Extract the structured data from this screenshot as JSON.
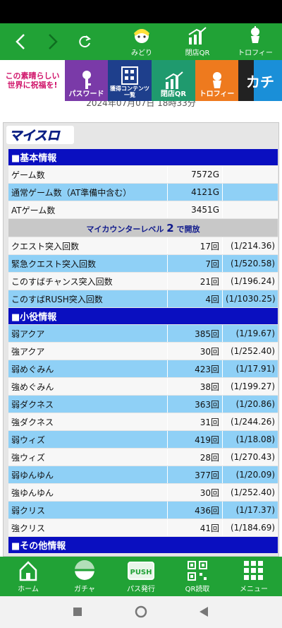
{
  "nav": {
    "midori_label": "みどり",
    "close_qr_label": "閉店QR",
    "trophy_label": "トロフィー"
  },
  "banner": {
    "promo_text": "この素晴らしい世界に祝福を!",
    "password_label": "パスワード",
    "contents_label": "獲得コンテンツ一覧",
    "close_qr_label": "閉店QR",
    "trophy_label": "トロフィー",
    "katana_label": "カチ"
  },
  "page": {
    "datetime": "2024年07月07日 18時33分",
    "logo_text": "マイスロ"
  },
  "basic": {
    "header": "■基本情報",
    "rows": [
      {
        "label": "ゲーム数",
        "value": "7572G",
        "ratio": ""
      },
      {
        "label": "通常ゲーム数（AT準備中含む）",
        "value": "4121G",
        "ratio": ""
      },
      {
        "label": "ATゲーム数",
        "value": "3451G",
        "ratio": ""
      }
    ],
    "notice_pre": "マイカウンターレベル ",
    "notice_level": "2",
    "notice_post": " で開放",
    "counts": [
      {
        "label": "クエスト突入回数",
        "value": "17回",
        "ratio": "(1/214.36)"
      },
      {
        "label": "緊急クエスト突入回数",
        "value": "7回",
        "ratio": "(1/520.58)"
      },
      {
        "label": "このすばチャンス突入回数",
        "value": "21回",
        "ratio": "(1/196.24)"
      },
      {
        "label": "このすばRUSH突入回数",
        "value": "4回",
        "ratio": "(1/1030.25)"
      }
    ]
  },
  "small": {
    "header": "■小役情報",
    "rows": [
      {
        "label": "弱アクア",
        "value": "385回",
        "ratio": "(1/19.67)"
      },
      {
        "label": "強アクア",
        "value": "30回",
        "ratio": "(1/252.40)"
      },
      {
        "label": "弱めぐみん",
        "value": "423回",
        "ratio": "(1/17.91)"
      },
      {
        "label": "強めぐみん",
        "value": "38回",
        "ratio": "(1/199.27)"
      },
      {
        "label": "弱ダクネス",
        "value": "363回",
        "ratio": "(1/20.86)"
      },
      {
        "label": "強ダクネス",
        "value": "31回",
        "ratio": "(1/244.26)"
      },
      {
        "label": "弱ウィズ",
        "value": "419回",
        "ratio": "(1/18.08)"
      },
      {
        "label": "強ウィズ",
        "value": "28回",
        "ratio": "(1/270.43)"
      },
      {
        "label": "弱ゆんゆん",
        "value": "377回",
        "ratio": "(1/20.09)"
      },
      {
        "label": "強ゆんゆん",
        "value": "30回",
        "ratio": "(1/252.40)"
      },
      {
        "label": "弱クリス",
        "value": "436回",
        "ratio": "(1/17.37)"
      },
      {
        "label": "強クリス",
        "value": "41回",
        "ratio": "(1/184.69)"
      }
    ]
  },
  "other": {
    "header": "■その他情報"
  },
  "tabs": {
    "home": "ホーム",
    "gacha": "ガチャ",
    "pass": "パス発行",
    "qr": "QR読取",
    "menu": "メニュー",
    "push_text": "PUSH"
  },
  "colors": {
    "green": "#21a236",
    "section_blue": "#0a0fc0",
    "row_blue": "#8fd0f6"
  }
}
